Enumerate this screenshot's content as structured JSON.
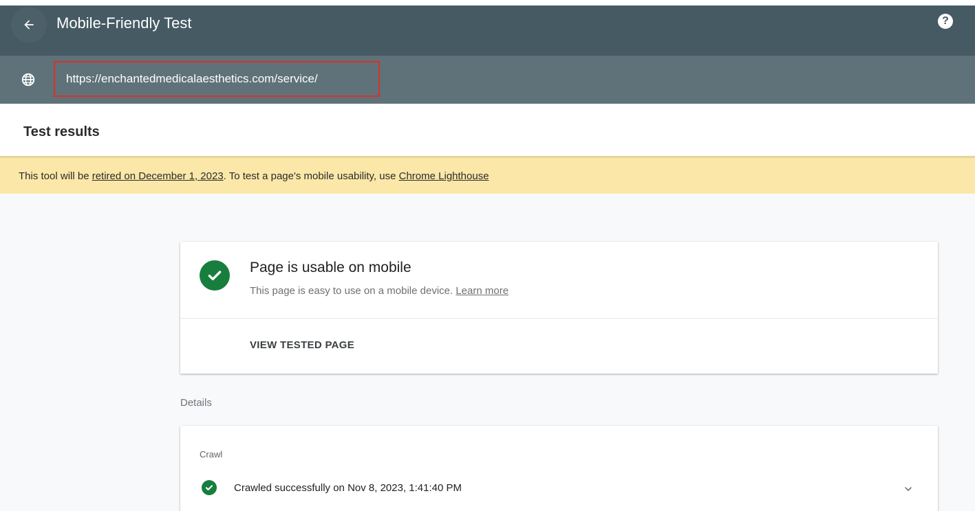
{
  "header": {
    "title": "Mobile-Friendly Test",
    "back_icon": "arrow-back-icon",
    "help_icon": "help-icon",
    "help_glyph": "?"
  },
  "url_bar": {
    "icon": "globe-icon",
    "url": "https://enchantedmedicalaesthetics.com/service/",
    "highlight_color": "#d9302a"
  },
  "results": {
    "title": "Test results"
  },
  "banner": {
    "prefix": "This tool will be ",
    "retired_link": "retired on December 1, 2023",
    "middle": ". To test a page's mobile usability, use ",
    "lighthouse_link": "Chrome Lighthouse",
    "background_color": "#fbe8a8"
  },
  "summary_card": {
    "status_icon": "check-circle-icon",
    "title": "Page is usable on mobile",
    "subtitle": "This page is easy to use on a mobile device. ",
    "learn_more": "Learn more",
    "view_button": "VIEW TESTED PAGE",
    "status_color": "#177e3e"
  },
  "details": {
    "label": "Details",
    "crawl": {
      "label": "Crawl",
      "status_icon": "check-circle-icon",
      "text": "Crawled successfully on Nov 8, 2023, 1:41:40 PM",
      "expand_icon": "chevron-down-icon"
    }
  }
}
